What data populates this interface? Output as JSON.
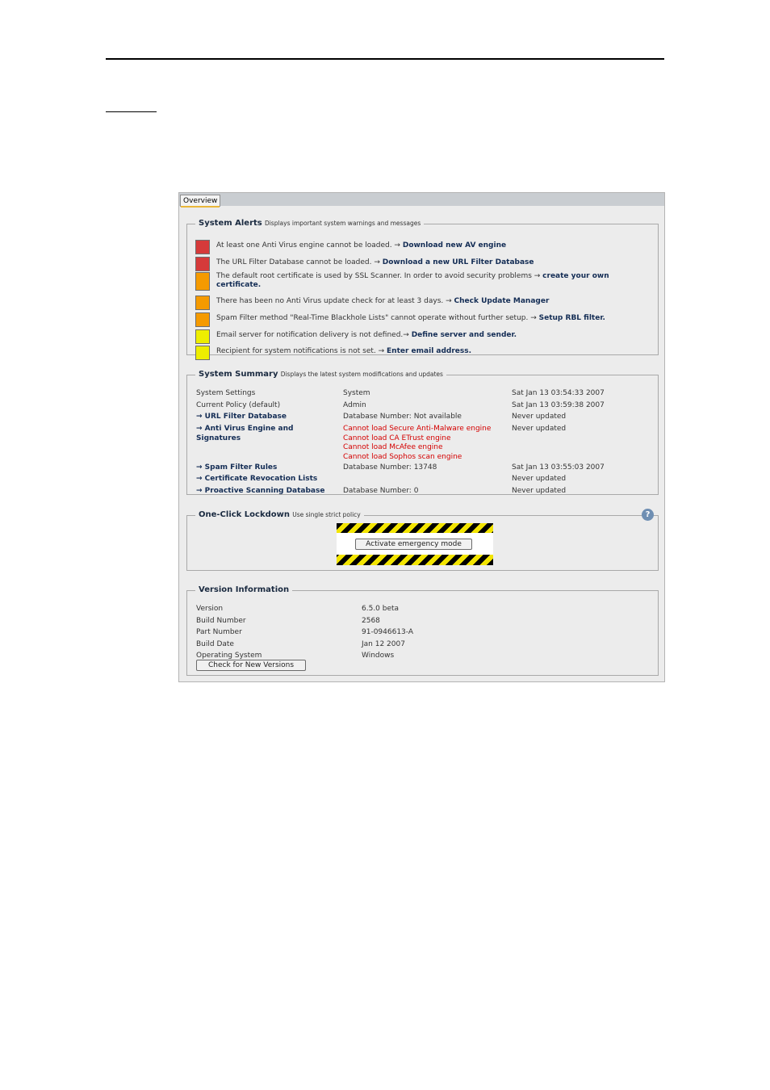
{
  "tab": {
    "label": "Overview"
  },
  "alerts": {
    "title": "System Alerts",
    "subtitle": "Displays important system warnings and messages",
    "items": [
      {
        "color": "#d63a3a",
        "text": "At least one Anti Virus engine cannot be loaded. → ",
        "link": "Download new AV engine"
      },
      {
        "color": "#d63a3a",
        "text": "The URL Filter Database cannot be loaded. → ",
        "link": "Download a new URL Filter Database"
      },
      {
        "color": "#f59a00",
        "text": "The default root certificate is used by SSL Scanner. In order to avoid security problems → ",
        "link": "create your own certificate."
      },
      {
        "color": "#f59a00",
        "text": "There has been no Anti Virus update check for at least 3 days. → ",
        "link": "Check Update Manager"
      },
      {
        "color": "#f59a00",
        "text": "Spam Filter method \"Real-Time Blackhole Lists\" cannot operate without further setup. → ",
        "link": "Setup RBL filter."
      },
      {
        "color": "#eeee00",
        "text": "Email server for notification delivery is not defined.→ ",
        "link": "Define server and sender."
      },
      {
        "color": "#eeee00",
        "text": "Recipient for system notifications is not set. → ",
        "link": "Enter email address."
      }
    ]
  },
  "summary": {
    "title": "System Summary",
    "subtitle": "Displays the latest system modifications and updates",
    "rows": [
      {
        "name": "System Settings",
        "link": false,
        "value": [
          "System"
        ],
        "error": false,
        "date": "Sat Jan 13 03:54:33 2007"
      },
      {
        "name": "Current Policy (default)",
        "link": false,
        "value": [
          "Admin"
        ],
        "error": false,
        "date": "Sat Jan 13 03:59:38 2007"
      },
      {
        "name": "→ URL Filter Database",
        "link": true,
        "value": [
          "Database Number: Not available"
        ],
        "error": false,
        "date": "Never updated"
      },
      {
        "name": "→ Anti Virus Engine and Signatures",
        "link": true,
        "value": [
          "Cannot load Secure Anti-Malware engine",
          "Cannot load CA ETrust engine",
          "Cannot load McAfee engine",
          "Cannot load Sophos scan engine"
        ],
        "error": true,
        "date": "Never updated"
      },
      {
        "name": "→ Spam Filter Rules",
        "link": true,
        "value": [
          "Database Number: 13748"
        ],
        "error": false,
        "date": "Sat Jan 13 03:55:03 2007"
      },
      {
        "name": "→ Certificate Revocation Lists",
        "link": true,
        "value": [
          ""
        ],
        "error": false,
        "date": "Never updated"
      },
      {
        "name": "→ Proactive Scanning Database",
        "link": true,
        "value": [
          "Database Number: 0"
        ],
        "error": false,
        "date": "Never updated"
      }
    ]
  },
  "lockdown": {
    "title": "One-Click Lockdown",
    "subtitle": "Use single strict policy",
    "button": "Activate emergency mode",
    "help": "?"
  },
  "version": {
    "title": "Version Information",
    "rows": [
      {
        "label": "Version",
        "value": "6.5.0 beta"
      },
      {
        "label": "Build Number",
        "value": "2568"
      },
      {
        "label": "Part Number",
        "value": "91-0946613-A"
      },
      {
        "label": "Build Date",
        "value": "Jan 12 2007"
      },
      {
        "label": "Operating System",
        "value": "Windows"
      }
    ],
    "button": "Check for New Versions"
  }
}
